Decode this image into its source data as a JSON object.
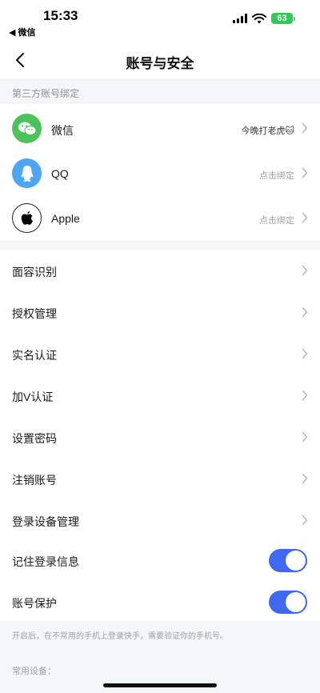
{
  "status_bar": {
    "time": "15:33",
    "back_app": "◀ 微信",
    "battery": "63"
  },
  "nav": {
    "title": "账号与安全"
  },
  "third_party": {
    "header": "第三方账号绑定",
    "items": [
      {
        "label": "微信",
        "value": "今晚打老虎🐱",
        "icon": "wechat-icon",
        "color": "#4cc35a"
      },
      {
        "label": "QQ",
        "value": "点击绑定",
        "icon": "qq-icon",
        "color": "#4ca5f5"
      },
      {
        "label": "Apple",
        "value": "点击绑定",
        "icon": "apple-icon",
        "color": "#000000"
      }
    ]
  },
  "settings": {
    "items": [
      {
        "label": "面容识别"
      },
      {
        "label": "授权管理"
      },
      {
        "label": "实名认证"
      },
      {
        "label": "加V认证"
      },
      {
        "label": "设置密码"
      },
      {
        "label": "注销账号"
      },
      {
        "label": "登录设备管理"
      }
    ],
    "toggles": [
      {
        "label": "记住登录信息",
        "on": true
      },
      {
        "label": "账号保护",
        "on": true
      }
    ]
  },
  "hint": "开启后，在不常用的手机上登录快手，需要验证你的手机号。",
  "devices_header": "常用设备：",
  "colors": {
    "accent": "#3f6af0",
    "background": "#f5f6f8"
  }
}
